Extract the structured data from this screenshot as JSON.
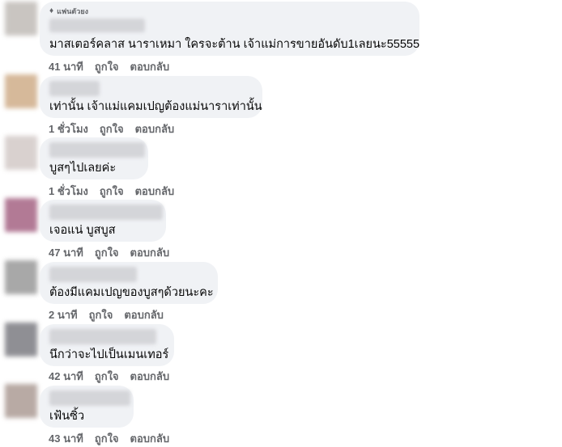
{
  "comments": [
    {
      "badge": "แฟนตัวยง",
      "text": "มาสเตอร์คลาส นาราเหมา ใครจะต้าน เจ้าแม่การขายอันดับ1เลยนะ55555",
      "time": "41 นาที",
      "like": "ถูกใจ",
      "reply": "ตอบกลับ",
      "avatar_color": "#c9c5c1"
    },
    {
      "badge": "",
      "text": "เท่านั้น เจ้าแม่แคมเปญต้องแม่นาราเท่านั้น",
      "time": "1 ชั่วโมง",
      "like": "ถูกใจ",
      "reply": "ตอบกลับ",
      "avatar_color": "#d6b99a"
    },
    {
      "badge": "",
      "text": "บูสๆไปเลยค่ะ",
      "time": "1 ชั่วโมง",
      "like": "ถูกใจ",
      "reply": "ตอบกลับ",
      "avatar_color": "#d9d1cf"
    },
    {
      "badge": "",
      "text": "เจอแน่ บูสบูส",
      "time": "47 นาที",
      "like": "ถูกใจ",
      "reply": "ตอบกลับ",
      "avatar_color": "#b27a95"
    },
    {
      "badge": "",
      "text": "ต้องมีแคมเปญของบูสๆด้วยนะคะ",
      "time": "2 นาที",
      "like": "ถูกใจ",
      "reply": "ตอบกลับ",
      "avatar_color": "#a8a8a8"
    },
    {
      "badge": "",
      "text": "นึกว่าจะไปเป็นเมนเทอร์",
      "time": "42 นาที",
      "like": "ถูกใจ",
      "reply": "ตอบกลับ",
      "avatar_color": "#8f8f94"
    },
    {
      "badge": "",
      "text": "เฟ้นซิ้ว",
      "time": "43 นาที",
      "like": "ถูกใจ",
      "reply": "ตอบกลับ",
      "avatar_color": "#b8aaa4"
    }
  ]
}
